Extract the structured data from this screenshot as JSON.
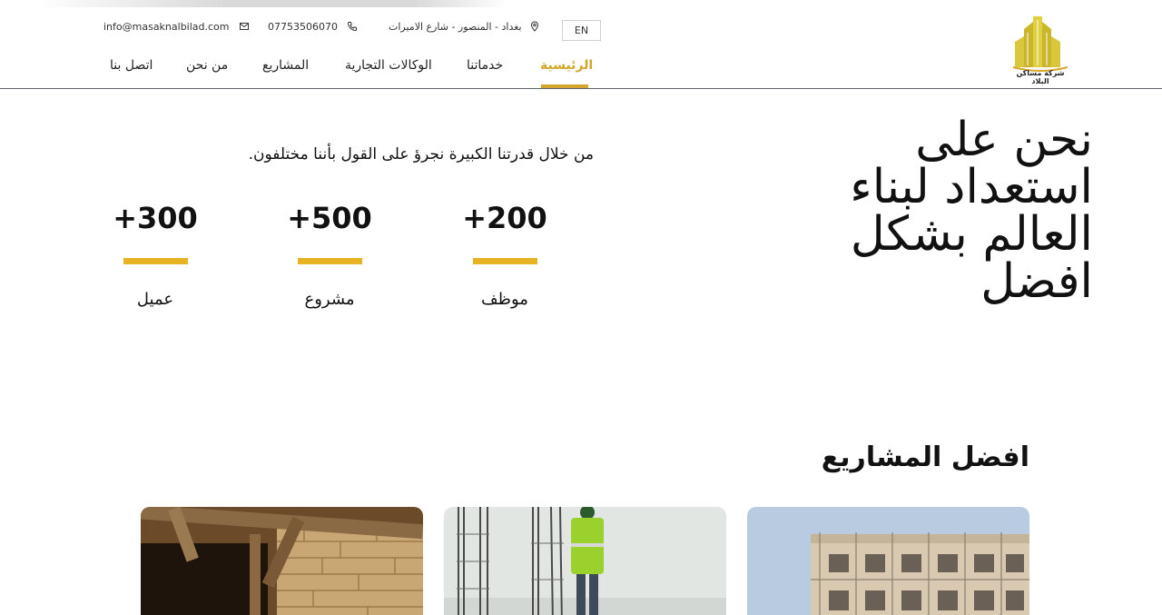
{
  "header": {
    "lang_button": "EN",
    "logo_text": "شركة مساكن البلاد",
    "address": "بغداد - المنصور - شارع الاميرات",
    "phone": "07753506070",
    "email": "info@masaknalbilad.com"
  },
  "nav": {
    "items": [
      {
        "label": "الرئيسية",
        "active": true
      },
      {
        "label": "خدماتنا"
      },
      {
        "label": "الوكالات التجارية"
      },
      {
        "label": "المشاريع"
      },
      {
        "label": "من نحن"
      },
      {
        "label": "اتصل بنا"
      }
    ]
  },
  "hero": {
    "title": "نحن على استعداد لبناء العالم بشكل افضل",
    "subtitle": "من خلال قدرتنا الكبيرة نجرؤ على القول بأننا مختلفون."
  },
  "stats": [
    {
      "value": "+200",
      "label": "موظف"
    },
    {
      "value": "+500",
      "label": "مشروع"
    },
    {
      "value": "+300",
      "label": "عميل"
    }
  ],
  "projects": {
    "title": "افضل المشاريع"
  },
  "colors": {
    "accent": "#e6b422",
    "nav_active": "#d4a72c"
  }
}
